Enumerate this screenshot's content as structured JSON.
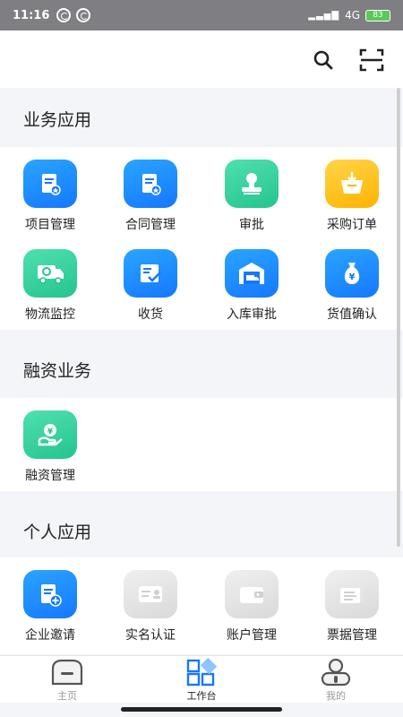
{
  "status": {
    "time": "11:16",
    "network": "4G",
    "battery": "83"
  },
  "sections": {
    "business": {
      "title": "业务应用",
      "items": [
        "项目管理",
        "合同管理",
        "审批",
        "采购订单",
        "物流监控",
        "收货",
        "入库审批",
        "货值确认"
      ]
    },
    "finance": {
      "title": "融资业务",
      "items": [
        "融资管理"
      ]
    },
    "personal": {
      "title": "个人应用",
      "items": [
        "企业邀请",
        "实名认证",
        "账户管理",
        "票据管理"
      ]
    }
  },
  "tabbar": {
    "home": "主页",
    "workbench": "工作台",
    "mine": "我的"
  },
  "icons": {
    "top": [
      "search-icon",
      "scan-icon"
    ],
    "business": [
      "project-doc-icon",
      "contract-doc-icon",
      "approval-stamp-icon",
      "purchase-order-icon",
      "logistics-truck-icon",
      "receipt-check-icon",
      "warehouse-inbound-icon",
      "money-bag-icon"
    ],
    "finance": [
      "hand-coin-icon"
    ],
    "personal": [
      "enterprise-invite-icon",
      "id-card-icon",
      "wallet-icon",
      "bill-icon"
    ]
  },
  "colors": {
    "accent_blue": "#1677ff",
    "green": "#25c48e",
    "yellow": "#ffb300",
    "disabled": "#d9d9d9"
  }
}
